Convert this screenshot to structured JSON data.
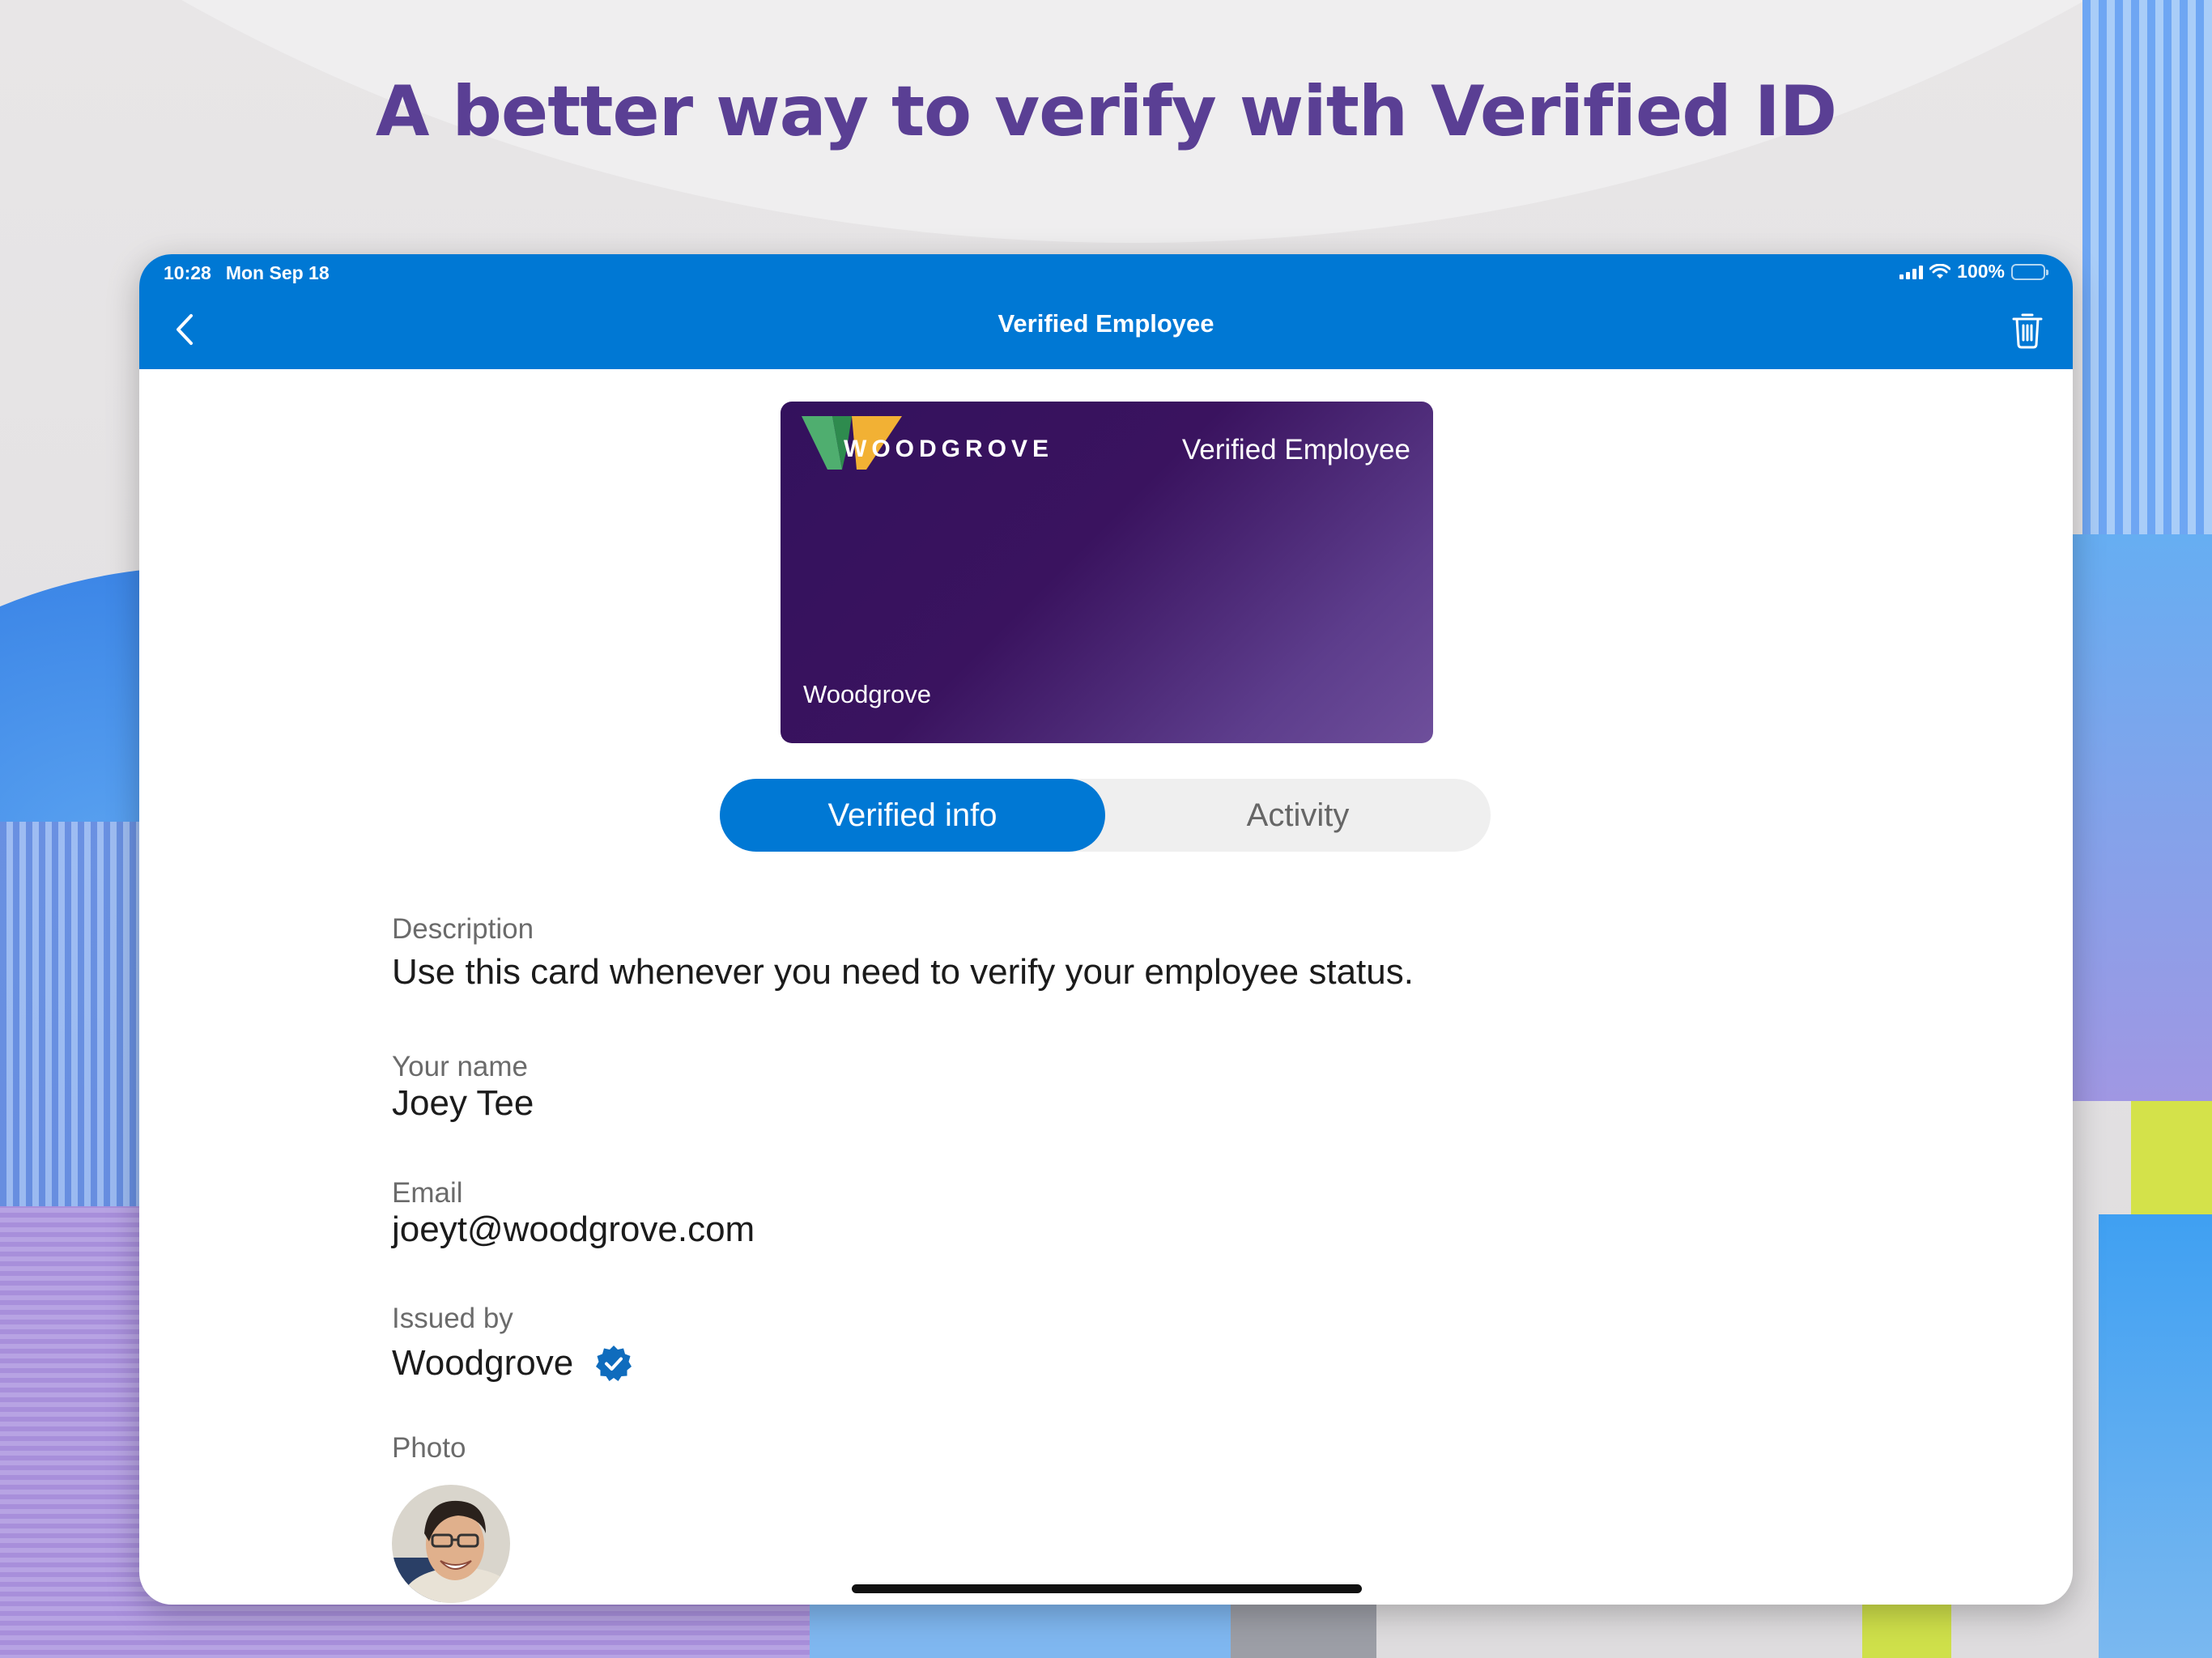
{
  "headline": "A better way to verify with Verified ID",
  "status_bar": {
    "time": "10:28",
    "date": "Mon Sep 18",
    "battery": "100%"
  },
  "nav": {
    "title": "Verified Employee",
    "back_icon": "chevron-left-icon",
    "delete_icon": "trash-icon"
  },
  "card": {
    "logo_text": "WOODGROVE",
    "type": "Verified Employee",
    "issuer": "Woodgrove"
  },
  "tabs": [
    {
      "label": "Verified info",
      "active": true
    },
    {
      "label": "Activity",
      "active": false
    }
  ],
  "fields": {
    "description": {
      "label": "Description",
      "value": "Use this card whenever you need to verify your employee status."
    },
    "name": {
      "label": "Your name",
      "value": "Joey Tee"
    },
    "email": {
      "label": "Email",
      "value": "joeyt@woodgrove.com"
    },
    "issued_by": {
      "label": "Issued by",
      "value": "Woodgrove",
      "badge_icon": "verified-badge-icon"
    },
    "photo": {
      "label": "Photo"
    }
  },
  "colors": {
    "accent": "#0078d4",
    "headline": "#5a3f94",
    "card": "#3a135f"
  }
}
